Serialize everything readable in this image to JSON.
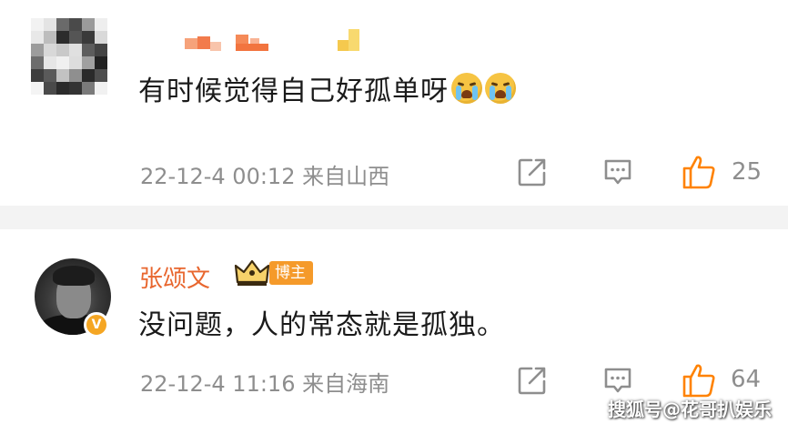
{
  "comments": [
    {
      "text": "有时候觉得自己好孤单呀",
      "emojis": [
        "crying-face",
        "crying-face"
      ],
      "timestamp": "22-12-4 00:12",
      "location": "来自山西",
      "likes": "25"
    },
    {
      "username": "张颂文",
      "badge": "博主",
      "avatar_badge": "V",
      "text": "没问题，人的常态就是孤独。",
      "timestamp": "22-12-4 11:16",
      "location": "来自海南",
      "likes": "64"
    }
  ],
  "watermark": "搜狐号@花哥扒娱乐",
  "colors": {
    "accent": "#e8662e",
    "like_icon": "#ff8200",
    "badge": "#f59a2a",
    "verified": "#f5a623",
    "meta_text": "#8e8e8e",
    "divider": "#f3f3f3"
  },
  "icons": {
    "share": "share-external-icon",
    "comment": "comment-bubble-icon",
    "like": "thumbs-up-icon",
    "crown": "crown-level-icon"
  }
}
